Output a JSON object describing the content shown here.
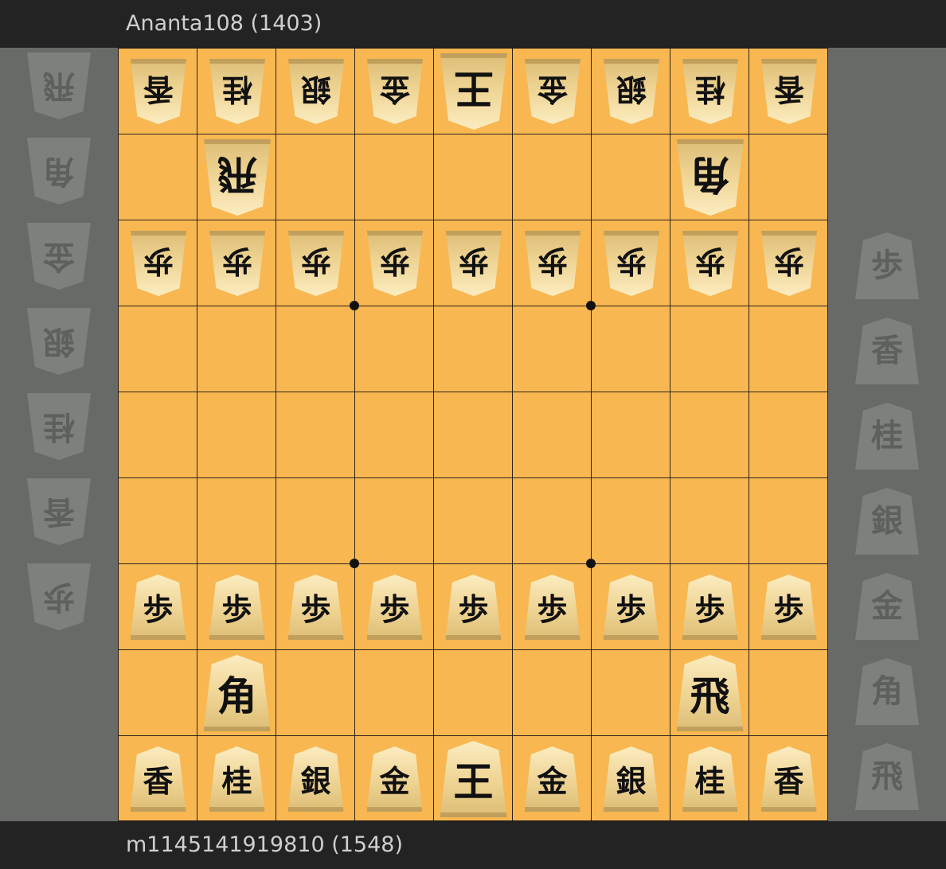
{
  "players": {
    "top": "Ananta108 (1403)",
    "bottom": "m1145141919810 (1548)"
  },
  "colors": {
    "board": "#f8b751",
    "lines": "#2b2418",
    "panel": "#676a67",
    "bar": "#232323"
  },
  "board": {
    "files": 9,
    "ranks": 9,
    "pieces": [
      {
        "kanji": "香",
        "side": "gote",
        "rank": 0,
        "file": 0
      },
      {
        "kanji": "桂",
        "side": "gote",
        "rank": 0,
        "file": 1
      },
      {
        "kanji": "銀",
        "side": "gote",
        "rank": 0,
        "file": 2
      },
      {
        "kanji": "金",
        "side": "gote",
        "rank": 0,
        "file": 3
      },
      {
        "kanji": "王",
        "side": "gote",
        "rank": 0,
        "file": 4,
        "big": true
      },
      {
        "kanji": "金",
        "side": "gote",
        "rank": 0,
        "file": 5
      },
      {
        "kanji": "銀",
        "side": "gote",
        "rank": 0,
        "file": 6
      },
      {
        "kanji": "桂",
        "side": "gote",
        "rank": 0,
        "file": 7
      },
      {
        "kanji": "香",
        "side": "gote",
        "rank": 0,
        "file": 8
      },
      {
        "kanji": "飛",
        "side": "gote",
        "rank": 1,
        "file": 1,
        "big": true
      },
      {
        "kanji": "角",
        "side": "gote",
        "rank": 1,
        "file": 7,
        "big": true
      },
      {
        "kanji": "歩",
        "side": "gote",
        "rank": 2,
        "file": 0
      },
      {
        "kanji": "歩",
        "side": "gote",
        "rank": 2,
        "file": 1
      },
      {
        "kanji": "歩",
        "side": "gote",
        "rank": 2,
        "file": 2
      },
      {
        "kanji": "歩",
        "side": "gote",
        "rank": 2,
        "file": 3
      },
      {
        "kanji": "歩",
        "side": "gote",
        "rank": 2,
        "file": 4
      },
      {
        "kanji": "歩",
        "side": "gote",
        "rank": 2,
        "file": 5
      },
      {
        "kanji": "歩",
        "side": "gote",
        "rank": 2,
        "file": 6
      },
      {
        "kanji": "歩",
        "side": "gote",
        "rank": 2,
        "file": 7
      },
      {
        "kanji": "歩",
        "side": "gote",
        "rank": 2,
        "file": 8
      },
      {
        "kanji": "歩",
        "side": "sente",
        "rank": 6,
        "file": 0
      },
      {
        "kanji": "歩",
        "side": "sente",
        "rank": 6,
        "file": 1
      },
      {
        "kanji": "歩",
        "side": "sente",
        "rank": 6,
        "file": 2
      },
      {
        "kanji": "歩",
        "side": "sente",
        "rank": 6,
        "file": 3
      },
      {
        "kanji": "歩",
        "side": "sente",
        "rank": 6,
        "file": 4
      },
      {
        "kanji": "歩",
        "side": "sente",
        "rank": 6,
        "file": 5
      },
      {
        "kanji": "歩",
        "side": "sente",
        "rank": 6,
        "file": 6
      },
      {
        "kanji": "歩",
        "side": "sente",
        "rank": 6,
        "file": 7
      },
      {
        "kanji": "歩",
        "side": "sente",
        "rank": 6,
        "file": 8
      },
      {
        "kanji": "角",
        "side": "sente",
        "rank": 7,
        "file": 1,
        "big": true
      },
      {
        "kanji": "飛",
        "side": "sente",
        "rank": 7,
        "file": 7,
        "big": true
      },
      {
        "kanji": "香",
        "side": "sente",
        "rank": 8,
        "file": 0
      },
      {
        "kanji": "桂",
        "side": "sente",
        "rank": 8,
        "file": 1
      },
      {
        "kanji": "銀",
        "side": "sente",
        "rank": 8,
        "file": 2
      },
      {
        "kanji": "金",
        "side": "sente",
        "rank": 8,
        "file": 3
      },
      {
        "kanji": "王",
        "side": "sente",
        "rank": 8,
        "file": 4,
        "big": true
      },
      {
        "kanji": "金",
        "side": "sente",
        "rank": 8,
        "file": 5
      },
      {
        "kanji": "銀",
        "side": "sente",
        "rank": 8,
        "file": 6
      },
      {
        "kanji": "桂",
        "side": "sente",
        "rank": 8,
        "file": 7
      },
      {
        "kanji": "香",
        "side": "sente",
        "rank": 8,
        "file": 8
      }
    ]
  },
  "hands": {
    "gote": [
      "飛",
      "角",
      "金",
      "銀",
      "桂",
      "香",
      "歩"
    ],
    "sente": [
      "歩",
      "香",
      "桂",
      "銀",
      "金",
      "角",
      "飛"
    ]
  }
}
